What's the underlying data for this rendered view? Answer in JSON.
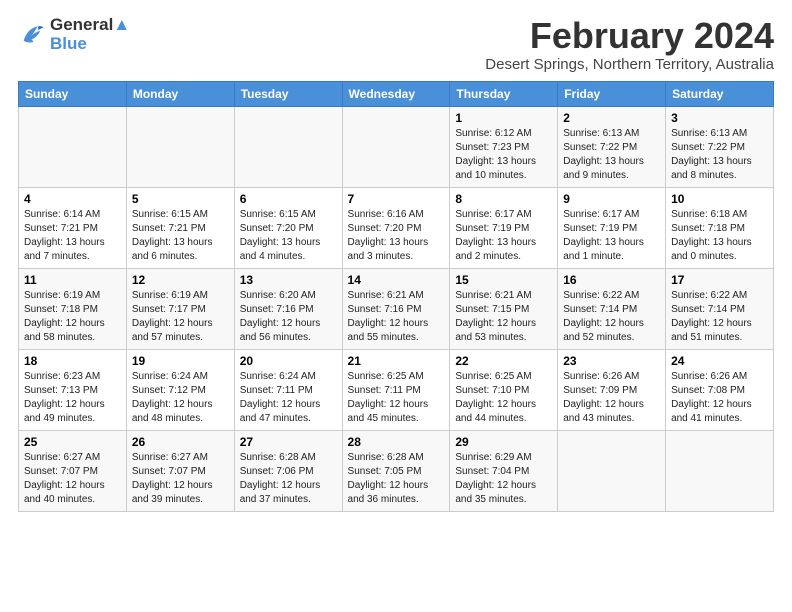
{
  "logo": {
    "line1": "General",
    "line2": "Blue"
  },
  "title": "February 2024",
  "subtitle": "Desert Springs, Northern Territory, Australia",
  "header_days": [
    "Sunday",
    "Monday",
    "Tuesday",
    "Wednesday",
    "Thursday",
    "Friday",
    "Saturday"
  ],
  "weeks": [
    [
      {
        "day": "",
        "content": ""
      },
      {
        "day": "",
        "content": ""
      },
      {
        "day": "",
        "content": ""
      },
      {
        "day": "",
        "content": ""
      },
      {
        "day": "1",
        "content": "Sunrise: 6:12 AM\nSunset: 7:23 PM\nDaylight: 13 hours\nand 10 minutes."
      },
      {
        "day": "2",
        "content": "Sunrise: 6:13 AM\nSunset: 7:22 PM\nDaylight: 13 hours\nand 9 minutes."
      },
      {
        "day": "3",
        "content": "Sunrise: 6:13 AM\nSunset: 7:22 PM\nDaylight: 13 hours\nand 8 minutes."
      }
    ],
    [
      {
        "day": "4",
        "content": "Sunrise: 6:14 AM\nSunset: 7:21 PM\nDaylight: 13 hours\nand 7 minutes."
      },
      {
        "day": "5",
        "content": "Sunrise: 6:15 AM\nSunset: 7:21 PM\nDaylight: 13 hours\nand 6 minutes."
      },
      {
        "day": "6",
        "content": "Sunrise: 6:15 AM\nSunset: 7:20 PM\nDaylight: 13 hours\nand 4 minutes."
      },
      {
        "day": "7",
        "content": "Sunrise: 6:16 AM\nSunset: 7:20 PM\nDaylight: 13 hours\nand 3 minutes."
      },
      {
        "day": "8",
        "content": "Sunrise: 6:17 AM\nSunset: 7:19 PM\nDaylight: 13 hours\nand 2 minutes."
      },
      {
        "day": "9",
        "content": "Sunrise: 6:17 AM\nSunset: 7:19 PM\nDaylight: 13 hours\nand 1 minute."
      },
      {
        "day": "10",
        "content": "Sunrise: 6:18 AM\nSunset: 7:18 PM\nDaylight: 13 hours\nand 0 minutes."
      }
    ],
    [
      {
        "day": "11",
        "content": "Sunrise: 6:19 AM\nSunset: 7:18 PM\nDaylight: 12 hours\nand 58 minutes."
      },
      {
        "day": "12",
        "content": "Sunrise: 6:19 AM\nSunset: 7:17 PM\nDaylight: 12 hours\nand 57 minutes."
      },
      {
        "day": "13",
        "content": "Sunrise: 6:20 AM\nSunset: 7:16 PM\nDaylight: 12 hours\nand 56 minutes."
      },
      {
        "day": "14",
        "content": "Sunrise: 6:21 AM\nSunset: 7:16 PM\nDaylight: 12 hours\nand 55 minutes."
      },
      {
        "day": "15",
        "content": "Sunrise: 6:21 AM\nSunset: 7:15 PM\nDaylight: 12 hours\nand 53 minutes."
      },
      {
        "day": "16",
        "content": "Sunrise: 6:22 AM\nSunset: 7:14 PM\nDaylight: 12 hours\nand 52 minutes."
      },
      {
        "day": "17",
        "content": "Sunrise: 6:22 AM\nSunset: 7:14 PM\nDaylight: 12 hours\nand 51 minutes."
      }
    ],
    [
      {
        "day": "18",
        "content": "Sunrise: 6:23 AM\nSunset: 7:13 PM\nDaylight: 12 hours\nand 49 minutes."
      },
      {
        "day": "19",
        "content": "Sunrise: 6:24 AM\nSunset: 7:12 PM\nDaylight: 12 hours\nand 48 minutes."
      },
      {
        "day": "20",
        "content": "Sunrise: 6:24 AM\nSunset: 7:11 PM\nDaylight: 12 hours\nand 47 minutes."
      },
      {
        "day": "21",
        "content": "Sunrise: 6:25 AM\nSunset: 7:11 PM\nDaylight: 12 hours\nand 45 minutes."
      },
      {
        "day": "22",
        "content": "Sunrise: 6:25 AM\nSunset: 7:10 PM\nDaylight: 12 hours\nand 44 minutes."
      },
      {
        "day": "23",
        "content": "Sunrise: 6:26 AM\nSunset: 7:09 PM\nDaylight: 12 hours\nand 43 minutes."
      },
      {
        "day": "24",
        "content": "Sunrise: 6:26 AM\nSunset: 7:08 PM\nDaylight: 12 hours\nand 41 minutes."
      }
    ],
    [
      {
        "day": "25",
        "content": "Sunrise: 6:27 AM\nSunset: 7:07 PM\nDaylight: 12 hours\nand 40 minutes."
      },
      {
        "day": "26",
        "content": "Sunrise: 6:27 AM\nSunset: 7:07 PM\nDaylight: 12 hours\nand 39 minutes."
      },
      {
        "day": "27",
        "content": "Sunrise: 6:28 AM\nSunset: 7:06 PM\nDaylight: 12 hours\nand 37 minutes."
      },
      {
        "day": "28",
        "content": "Sunrise: 6:28 AM\nSunset: 7:05 PM\nDaylight: 12 hours\nand 36 minutes."
      },
      {
        "day": "29",
        "content": "Sunrise: 6:29 AM\nSunset: 7:04 PM\nDaylight: 12 hours\nand 35 minutes."
      },
      {
        "day": "",
        "content": ""
      },
      {
        "day": "",
        "content": ""
      }
    ]
  ]
}
